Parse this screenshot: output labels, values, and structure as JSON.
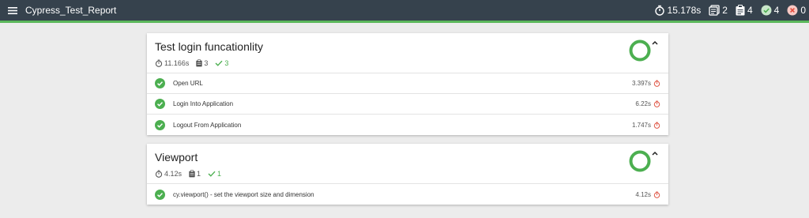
{
  "app": {
    "title": "Cypress_Test_Report"
  },
  "stats": {
    "duration": "15.178s",
    "suites": "2",
    "tests": "4",
    "passes": "4",
    "failures": "0"
  },
  "colors": {
    "topbar": "#36424d",
    "accent_green": "#5cb85c",
    "pass": "#4caf50",
    "fail": "#e74c3c",
    "timer_red": "#e05a4a"
  },
  "suites": [
    {
      "title": "Test login funcationlity",
      "duration": "11.166s",
      "tests_count": "3",
      "passes_count": "3",
      "pass_ratio": 1,
      "tests": [
        {
          "title": "Open URL",
          "duration": "3.397s"
        },
        {
          "title": "Login Into Application",
          "duration": "6.22s"
        },
        {
          "title": "Logout From Application",
          "duration": "1.747s"
        }
      ]
    },
    {
      "title": "Viewport",
      "duration": "4.12s",
      "tests_count": "1",
      "passes_count": "1",
      "pass_ratio": 1,
      "tests": [
        {
          "title": "cy.viewport() - set the viewport size and dimension",
          "duration": "4.12s"
        }
      ]
    }
  ]
}
